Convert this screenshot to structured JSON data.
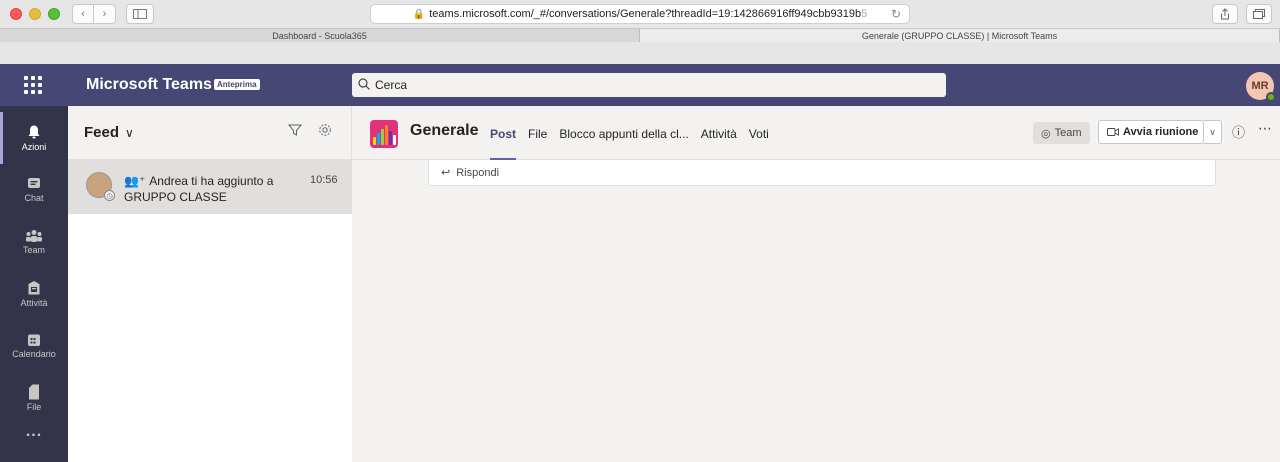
{
  "browser": {
    "url_main": "teams.microsoft.com/_#/conversations/Generale?threadId=19:142866916ff949cbb9319b",
    "url_fade": "5",
    "tabs": [
      "Dashboard - Scuola365",
      "Generale (GRUPPO CLASSE) | Microsoft Teams"
    ]
  },
  "header": {
    "app_title": "Microsoft Teams",
    "badge": "Anteprima",
    "search_placeholder": "Cerca",
    "user_initials": "MR"
  },
  "rail": {
    "items": [
      {
        "label": "Azioni",
        "icon": "bell-icon"
      },
      {
        "label": "Chat",
        "icon": "chat-icon"
      },
      {
        "label": "Team",
        "icon": "team-icon"
      },
      {
        "label": "Attività",
        "icon": "assignments-icon"
      },
      {
        "label": "Calendario",
        "icon": "calendar-icon"
      },
      {
        "label": "File",
        "icon": "file-icon"
      },
      {
        "label": "...",
        "icon": "more-icon"
      }
    ]
  },
  "feed": {
    "title": "Feed",
    "item": {
      "text": "Andrea ti ha aggiunto a GRUPPO CLASSE",
      "time": "10:56"
    }
  },
  "channel": {
    "name": "Generale",
    "tabs": [
      "Post",
      "File",
      "Blocco appunti della cl...",
      "Attività",
      "Voti"
    ],
    "team_label": "Team",
    "meet_label": "Avvia riunione",
    "reply_label": "Rispondi"
  },
  "colors": {
    "teams_purple": "#464775",
    "rail": "#33344a",
    "accent": "#6264a7"
  }
}
